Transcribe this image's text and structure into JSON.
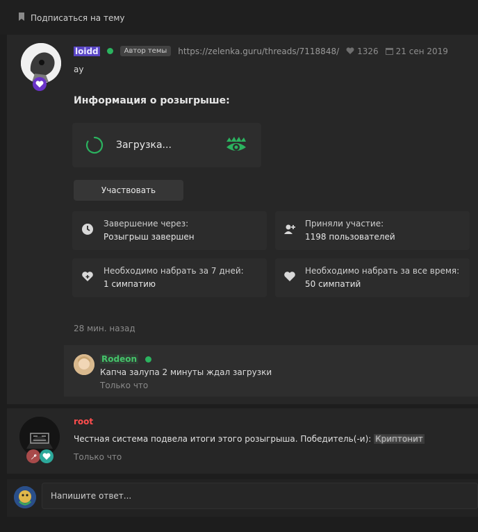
{
  "top": {
    "subscribe_label": "Подписаться на тему"
  },
  "post": {
    "username": "loidd",
    "author_tag": "Автор темы",
    "link": "https://zelenka.guru/threads/7118848/",
    "likes": "1326",
    "date": "21 сен 2019",
    "text": "ay",
    "giveaway_title": "Информация о розыгрыше:",
    "loading_label": "Загрузка...",
    "participate_label": "Участвовать",
    "info": [
      {
        "label": "Завершение через:",
        "value": "Розыгрыш завершен",
        "icon": "clock-icon"
      },
      {
        "label": "Приняли участие:",
        "value": "1198 пользователей",
        "icon": "user-plus-icon"
      },
      {
        "label": "Необходимо набрать за 7 дней:",
        "value": "1 симпатию",
        "icon": "heart-plus-icon"
      },
      {
        "label": "Необходимо набрать за все время:",
        "value": "50 симпатий",
        "icon": "heart-icon"
      }
    ],
    "time": "28 мин. назад"
  },
  "comment": {
    "username": "Rodeon",
    "text": "Капча залупа 2 минуты ждал загрузки",
    "time": "Только что"
  },
  "system": {
    "username": "root",
    "text": "Честная система подвела итоги этого розыгрыша. Победитель(-и):",
    "winner": "Криптонит",
    "time": "Только что"
  },
  "reply": {
    "placeholder": "Напишите ответ..."
  },
  "colors": {
    "accent_green": "#2bb35f",
    "username_root": "#ff4d4d",
    "background": "#1d1d1d",
    "panel": "#272727"
  }
}
